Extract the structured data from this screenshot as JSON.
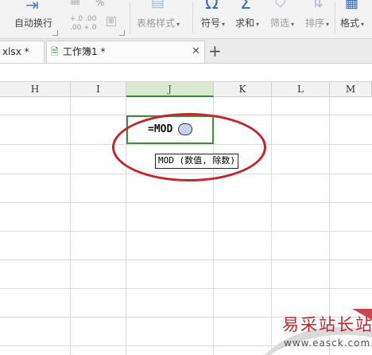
{
  "ribbon": {
    "items": [
      {
        "label": "自动换行",
        "name": "wrap-text-button"
      },
      {
        "label": "表格样式",
        "name": "table-style-button"
      },
      {
        "label": "符号",
        "name": "symbol-button"
      },
      {
        "label": "求和",
        "name": "sum-button"
      },
      {
        "label": "筛选",
        "name": "filter-button"
      },
      {
        "label": "排序",
        "name": "sort-button"
      },
      {
        "label": "格式",
        "name": "format-button"
      }
    ],
    "percent_glyph": "%",
    "increase_decimal": "+.0 .00",
    "decrease_decimal": ".00 +.0",
    "symbol_icon": "Ω",
    "sum_icon": "Σ"
  },
  "tabs": [
    {
      "label": "xlsx *",
      "close": "✕"
    },
    {
      "label": "工作簿1 *",
      "close": "✕"
    }
  ],
  "new_tab": "+",
  "columns": [
    "H",
    "I",
    "J",
    "K",
    "L",
    "M"
  ],
  "selected_column": "J",
  "cell": {
    "formula": "=MOD",
    "tooltip": "MOD (数值, 除数)"
  },
  "watermark": {
    "text": "易采站长站",
    "url": "www.easck.com"
  },
  "colors": {
    "accent": "#3b6fb6",
    "selection": "#3f8f3f",
    "annotation": "#c1272d"
  }
}
